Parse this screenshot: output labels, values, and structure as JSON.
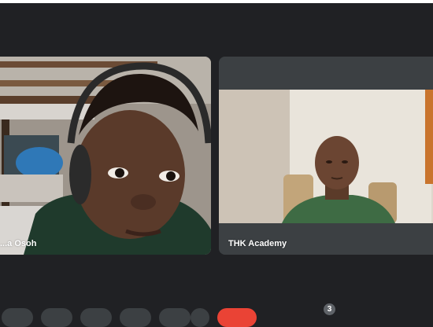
{
  "meeting": {
    "participant_count": "3",
    "tiles": [
      {
        "name": "...a Osoh"
      },
      {
        "name": "THK Academy"
      }
    ]
  },
  "colors": {
    "background": "#202124",
    "tile": "#3c4043",
    "end_call": "#ea4335"
  }
}
